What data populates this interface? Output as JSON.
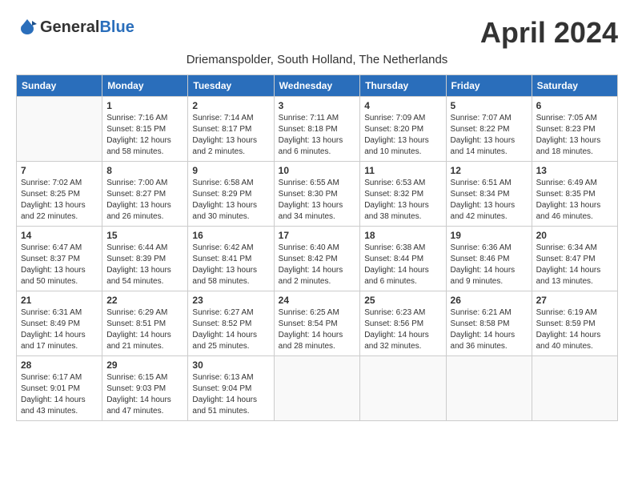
{
  "header": {
    "logo_general": "General",
    "logo_blue": "Blue",
    "month_title": "April 2024",
    "subtitle": "Driemanspolder, South Holland, The Netherlands"
  },
  "weekdays": [
    "Sunday",
    "Monday",
    "Tuesday",
    "Wednesday",
    "Thursday",
    "Friday",
    "Saturday"
  ],
  "weeks": [
    [
      {
        "day": "",
        "sunrise": "",
        "sunset": "",
        "daylight": ""
      },
      {
        "day": "1",
        "sunrise": "Sunrise: 7:16 AM",
        "sunset": "Sunset: 8:15 PM",
        "daylight": "Daylight: 12 hours and 58 minutes."
      },
      {
        "day": "2",
        "sunrise": "Sunrise: 7:14 AM",
        "sunset": "Sunset: 8:17 PM",
        "daylight": "Daylight: 13 hours and 2 minutes."
      },
      {
        "day": "3",
        "sunrise": "Sunrise: 7:11 AM",
        "sunset": "Sunset: 8:18 PM",
        "daylight": "Daylight: 13 hours and 6 minutes."
      },
      {
        "day": "4",
        "sunrise": "Sunrise: 7:09 AM",
        "sunset": "Sunset: 8:20 PM",
        "daylight": "Daylight: 13 hours and 10 minutes."
      },
      {
        "day": "5",
        "sunrise": "Sunrise: 7:07 AM",
        "sunset": "Sunset: 8:22 PM",
        "daylight": "Daylight: 13 hours and 14 minutes."
      },
      {
        "day": "6",
        "sunrise": "Sunrise: 7:05 AM",
        "sunset": "Sunset: 8:23 PM",
        "daylight": "Daylight: 13 hours and 18 minutes."
      }
    ],
    [
      {
        "day": "7",
        "sunrise": "Sunrise: 7:02 AM",
        "sunset": "Sunset: 8:25 PM",
        "daylight": "Daylight: 13 hours and 22 minutes."
      },
      {
        "day": "8",
        "sunrise": "Sunrise: 7:00 AM",
        "sunset": "Sunset: 8:27 PM",
        "daylight": "Daylight: 13 hours and 26 minutes."
      },
      {
        "day": "9",
        "sunrise": "Sunrise: 6:58 AM",
        "sunset": "Sunset: 8:29 PM",
        "daylight": "Daylight: 13 hours and 30 minutes."
      },
      {
        "day": "10",
        "sunrise": "Sunrise: 6:55 AM",
        "sunset": "Sunset: 8:30 PM",
        "daylight": "Daylight: 13 hours and 34 minutes."
      },
      {
        "day": "11",
        "sunrise": "Sunrise: 6:53 AM",
        "sunset": "Sunset: 8:32 PM",
        "daylight": "Daylight: 13 hours and 38 minutes."
      },
      {
        "day": "12",
        "sunrise": "Sunrise: 6:51 AM",
        "sunset": "Sunset: 8:34 PM",
        "daylight": "Daylight: 13 hours and 42 minutes."
      },
      {
        "day": "13",
        "sunrise": "Sunrise: 6:49 AM",
        "sunset": "Sunset: 8:35 PM",
        "daylight": "Daylight: 13 hours and 46 minutes."
      }
    ],
    [
      {
        "day": "14",
        "sunrise": "Sunrise: 6:47 AM",
        "sunset": "Sunset: 8:37 PM",
        "daylight": "Daylight: 13 hours and 50 minutes."
      },
      {
        "day": "15",
        "sunrise": "Sunrise: 6:44 AM",
        "sunset": "Sunset: 8:39 PM",
        "daylight": "Daylight: 13 hours and 54 minutes."
      },
      {
        "day": "16",
        "sunrise": "Sunrise: 6:42 AM",
        "sunset": "Sunset: 8:41 PM",
        "daylight": "Daylight: 13 hours and 58 minutes."
      },
      {
        "day": "17",
        "sunrise": "Sunrise: 6:40 AM",
        "sunset": "Sunset: 8:42 PM",
        "daylight": "Daylight: 14 hours and 2 minutes."
      },
      {
        "day": "18",
        "sunrise": "Sunrise: 6:38 AM",
        "sunset": "Sunset: 8:44 PM",
        "daylight": "Daylight: 14 hours and 6 minutes."
      },
      {
        "day": "19",
        "sunrise": "Sunrise: 6:36 AM",
        "sunset": "Sunset: 8:46 PM",
        "daylight": "Daylight: 14 hours and 9 minutes."
      },
      {
        "day": "20",
        "sunrise": "Sunrise: 6:34 AM",
        "sunset": "Sunset: 8:47 PM",
        "daylight": "Daylight: 14 hours and 13 minutes."
      }
    ],
    [
      {
        "day": "21",
        "sunrise": "Sunrise: 6:31 AM",
        "sunset": "Sunset: 8:49 PM",
        "daylight": "Daylight: 14 hours and 17 minutes."
      },
      {
        "day": "22",
        "sunrise": "Sunrise: 6:29 AM",
        "sunset": "Sunset: 8:51 PM",
        "daylight": "Daylight: 14 hours and 21 minutes."
      },
      {
        "day": "23",
        "sunrise": "Sunrise: 6:27 AM",
        "sunset": "Sunset: 8:52 PM",
        "daylight": "Daylight: 14 hours and 25 minutes."
      },
      {
        "day": "24",
        "sunrise": "Sunrise: 6:25 AM",
        "sunset": "Sunset: 8:54 PM",
        "daylight": "Daylight: 14 hours and 28 minutes."
      },
      {
        "day": "25",
        "sunrise": "Sunrise: 6:23 AM",
        "sunset": "Sunset: 8:56 PM",
        "daylight": "Daylight: 14 hours and 32 minutes."
      },
      {
        "day": "26",
        "sunrise": "Sunrise: 6:21 AM",
        "sunset": "Sunset: 8:58 PM",
        "daylight": "Daylight: 14 hours and 36 minutes."
      },
      {
        "day": "27",
        "sunrise": "Sunrise: 6:19 AM",
        "sunset": "Sunset: 8:59 PM",
        "daylight": "Daylight: 14 hours and 40 minutes."
      }
    ],
    [
      {
        "day": "28",
        "sunrise": "Sunrise: 6:17 AM",
        "sunset": "Sunset: 9:01 PM",
        "daylight": "Daylight: 14 hours and 43 minutes."
      },
      {
        "day": "29",
        "sunrise": "Sunrise: 6:15 AM",
        "sunset": "Sunset: 9:03 PM",
        "daylight": "Daylight: 14 hours and 47 minutes."
      },
      {
        "day": "30",
        "sunrise": "Sunrise: 6:13 AM",
        "sunset": "Sunset: 9:04 PM",
        "daylight": "Daylight: 14 hours and 51 minutes."
      },
      {
        "day": "",
        "sunrise": "",
        "sunset": "",
        "daylight": ""
      },
      {
        "day": "",
        "sunrise": "",
        "sunset": "",
        "daylight": ""
      },
      {
        "day": "",
        "sunrise": "",
        "sunset": "",
        "daylight": ""
      },
      {
        "day": "",
        "sunrise": "",
        "sunset": "",
        "daylight": ""
      }
    ]
  ]
}
